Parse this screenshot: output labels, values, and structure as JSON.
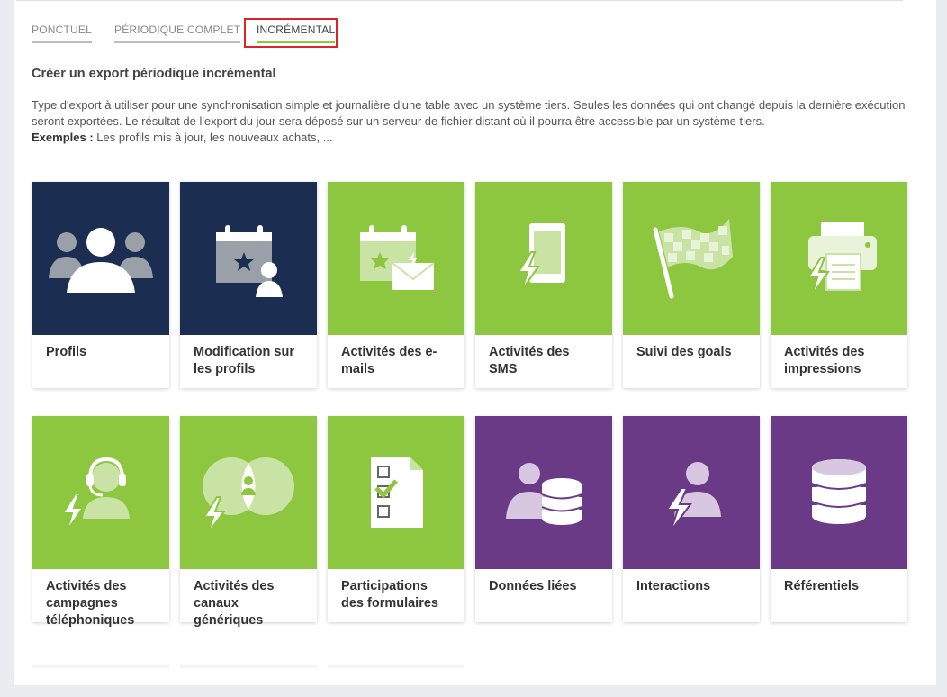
{
  "tabs": [
    {
      "label": "PONCTUEL"
    },
    {
      "label": "PÉRIODIQUE COMPLET"
    },
    {
      "label": "INCRÉMENTAL"
    }
  ],
  "active_tab": "INCRÉMENTAL",
  "heading": "Créer un export périodique incrémental",
  "description": {
    "text": "Type d'export à utiliser pour une synchronisation simple et journalière d'une table avec un système tiers. Seules les données qui ont changé depuis la dernière exécution seront exportées. Le résultat de l'export du jour sera déposé sur un serveur de fichier distant où il pourra être accessible par un système tiers.",
    "examples_label": "Exemples :",
    "examples_text": "Les profils mis à jour, les nouveaux achats, ..."
  },
  "cards": [
    {
      "label": "Profils",
      "icon": "group-icon",
      "color": "navy"
    },
    {
      "label": "Modification sur les profils",
      "icon": "calendar-profile-icon",
      "color": "navy"
    },
    {
      "label": "Activités des e-mails",
      "icon": "calendar-email-icon",
      "color": "green"
    },
    {
      "label": "Activités des SMS",
      "icon": "phone-lightning-icon",
      "color": "green"
    },
    {
      "label": "Suivi des goals",
      "icon": "checkered-flag-icon",
      "color": "green"
    },
    {
      "label": "Activités des impressions",
      "icon": "printer-lightning-icon",
      "color": "green"
    },
    {
      "label": "Activités des campagnes téléphoniques",
      "icon": "headset-lightning-icon",
      "color": "green"
    },
    {
      "label": "Activités des canaux génériques",
      "icon": "channels-lightning-icon",
      "color": "green"
    },
    {
      "label": "Participations des formulaires",
      "icon": "form-checklist-icon",
      "color": "green"
    },
    {
      "label": "Données liées",
      "icon": "user-database-icon",
      "color": "purple"
    },
    {
      "label": "Interactions",
      "icon": "user-lightning-icon",
      "color": "purple"
    },
    {
      "label": "Référentiels",
      "icon": "database-icon",
      "color": "purple"
    }
  ],
  "colors": {
    "navy": "#1c2d52",
    "green": "#8dc63f",
    "purple": "#6b3a87",
    "highlight": "#d9252a"
  }
}
